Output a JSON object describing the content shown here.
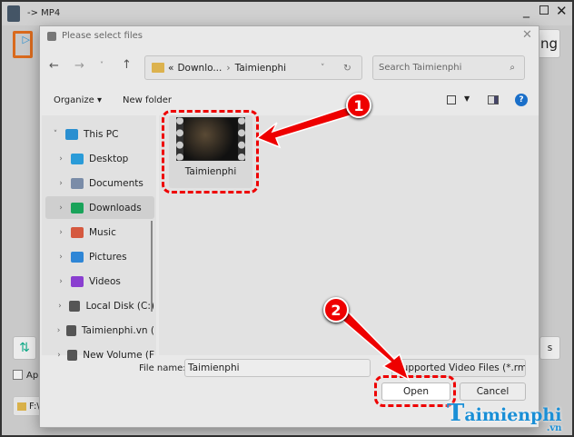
{
  "app": {
    "title": "-> MP4",
    "partial_button": "ng",
    "partial_right_button": "s",
    "checkbox_label": "App",
    "path_label": "F:\\",
    "window_controls": [
      "minimize",
      "maximize",
      "close"
    ]
  },
  "dialog": {
    "title": "Please select files",
    "address": {
      "prefix": "«",
      "crumbs": [
        "Downlo...",
        "Taimienphi"
      ]
    },
    "search_placeholder": "Search Taimienphi",
    "toolbar": {
      "organize": "Organize ▾",
      "new_folder": "New folder"
    },
    "nav": [
      {
        "label": "This PC",
        "icon": "computer-icon",
        "color": "#2a8fd0",
        "expanded": true
      },
      {
        "label": "Desktop",
        "icon": "desktop-icon",
        "color": "#2a9bd8"
      },
      {
        "label": "Documents",
        "icon": "documents-icon",
        "color": "#7a8ca8"
      },
      {
        "label": "Downloads",
        "icon": "download-icon",
        "color": "#1aa35a",
        "selected": true
      },
      {
        "label": "Music",
        "icon": "music-icon",
        "color": "#d5593f"
      },
      {
        "label": "Pictures",
        "icon": "pictures-icon",
        "color": "#2f86d6"
      },
      {
        "label": "Videos",
        "icon": "videos-icon",
        "color": "#8a3fd0"
      },
      {
        "label": "Local Disk (C:)",
        "icon": "drive-icon",
        "color": "#555"
      },
      {
        "label": "Taimienphi.vn (",
        "icon": "drive-icon",
        "color": "#555"
      },
      {
        "label": "New Volume (F",
        "icon": "drive-icon",
        "color": "#555"
      }
    ],
    "files": [
      {
        "name": "Taimienphi",
        "type": "video"
      }
    ],
    "filename_label": "File name:",
    "filename_value": "Taimienphi",
    "filter": "Supported Video Files (*.rm",
    "open": "Open",
    "cancel": "Cancel"
  },
  "annotations": [
    "1",
    "2"
  ],
  "watermark": {
    "text": "aimienphi",
    "suffix": ".vn",
    "initial": "T"
  },
  "colors": {
    "annotation": "#e00000",
    "watermark": "#1a8fd6"
  }
}
